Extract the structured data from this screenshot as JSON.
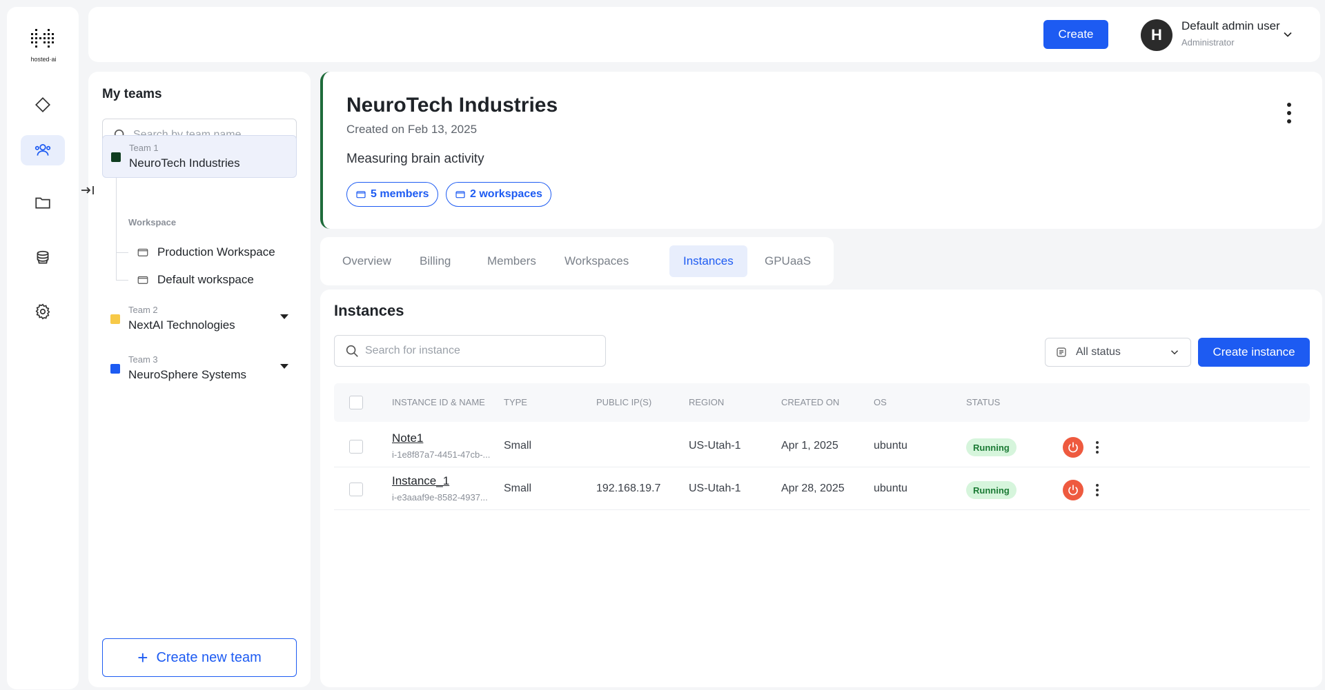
{
  "brand": {
    "logo_text": "hosted·ai"
  },
  "nav": {
    "items": [
      {
        "icon": "diamond-icon",
        "active": false
      },
      {
        "icon": "users-icon",
        "active": true
      },
      {
        "icon": "folder-icon",
        "active": false
      },
      {
        "icon": "stack-icon",
        "active": false
      },
      {
        "icon": "gear-icon",
        "active": false
      }
    ]
  },
  "topbar": {
    "create_label": "Create",
    "user": {
      "initial": "H",
      "name": "Default admin user",
      "role": "Administrator"
    }
  },
  "teams": {
    "title": "My teams",
    "search_placeholder": "Search by team name",
    "workspace_label": "Workspace",
    "items": [
      {
        "number": "Team 1",
        "name": "NeuroTech Industries",
        "color": "#0f3d1f",
        "expanded": true
      },
      {
        "number": "Team 2",
        "name": "NextAI Technologies",
        "color": "#f7c948",
        "expanded": false
      },
      {
        "number": "Team 3",
        "name": "NeuroSphere Systems",
        "color": "#1d5bf2",
        "expanded": false
      }
    ],
    "workspaces": [
      "Production Workspace",
      "Default workspace"
    ],
    "new_team_label": "Create new team"
  },
  "org": {
    "name": "NeuroTech Industries",
    "created": "Created on Feb 13, 2025",
    "description": "Measuring brain activity",
    "members_chip": "5 members",
    "workspaces_chip": "2 workspaces",
    "accent": "#1e6b3a"
  },
  "tabs": [
    {
      "label": "Overview",
      "active": false
    },
    {
      "label": "Billing",
      "active": false
    },
    {
      "label": "Members",
      "active": false
    },
    {
      "label": "Workspaces",
      "active": false
    },
    {
      "label": "Instances",
      "active": true
    },
    {
      "label": "GPUaaS",
      "active": false
    }
  ],
  "instances": {
    "title": "Instances",
    "search_placeholder": "Search for instance",
    "status_filter": "All status",
    "create_label": "Create instance",
    "columns": [
      "INSTANCE ID & NAME",
      "TYPE",
      "PUBLIC IP(S)",
      "REGION",
      "CREATED ON",
      "OS",
      "STATUS"
    ],
    "rows": [
      {
        "name": "Note1",
        "id": "i-1e8f87a7-4451-47cb-...",
        "type": "Small",
        "ip": "",
        "region": "US-Utah-1",
        "created": "Apr 1, 2025",
        "os": "ubuntu",
        "status": "Running"
      },
      {
        "name": "Instance_1",
        "id": "i-e3aaaf9e-8582-4937...",
        "type": "Small",
        "ip": "192.168.19.7",
        "region": "US-Utah-1",
        "created": "Apr 28, 2025",
        "os": "ubuntu",
        "status": "Running"
      }
    ]
  },
  "colors": {
    "primary": "#1d5bf2",
    "running_bg": "#d6f5dc",
    "running_text": "#1a7a34",
    "power": "#ee5a3f"
  }
}
